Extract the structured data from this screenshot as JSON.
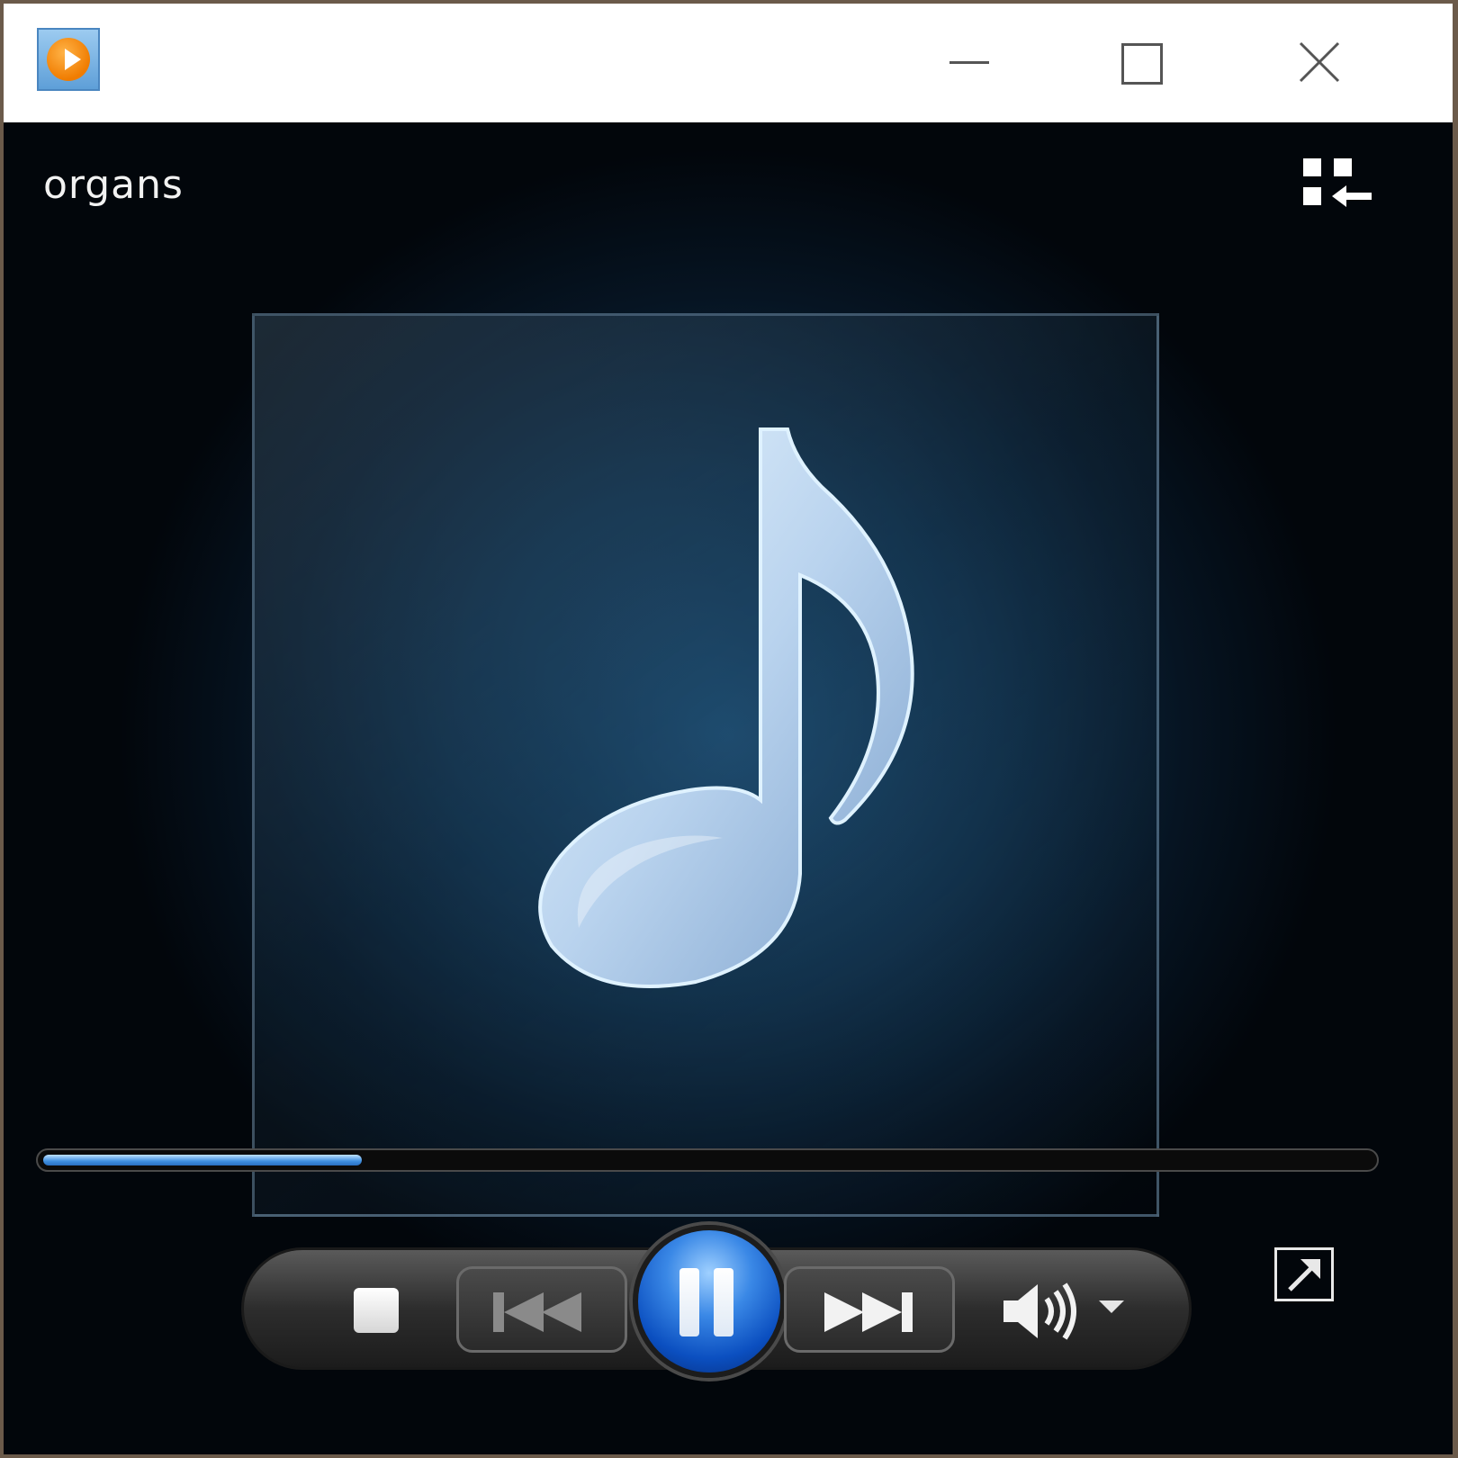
{
  "window": {
    "title": "",
    "controls": {
      "minimize_icon": "minimize-icon",
      "maximize_icon": "maximize-icon",
      "close_icon": "close-icon"
    }
  },
  "now_playing": {
    "track_title": "organs",
    "album_art": "music-note-icon",
    "progress": 0.24
  },
  "toolbar": {
    "switch_to_library_icon": "switch-to-library-icon",
    "stop_icon": "stop-icon",
    "previous_icon": "previous-icon",
    "pause_icon": "pause-icon",
    "next_icon": "next-icon",
    "volume_icon": "volume-icon",
    "volume_dropdown_icon": "chevron-down-icon",
    "fullscreen_icon": "fullscreen-icon"
  },
  "colors": {
    "accent": "#2a6fc0",
    "background": "#000000",
    "titlebar": "#ffffff"
  }
}
